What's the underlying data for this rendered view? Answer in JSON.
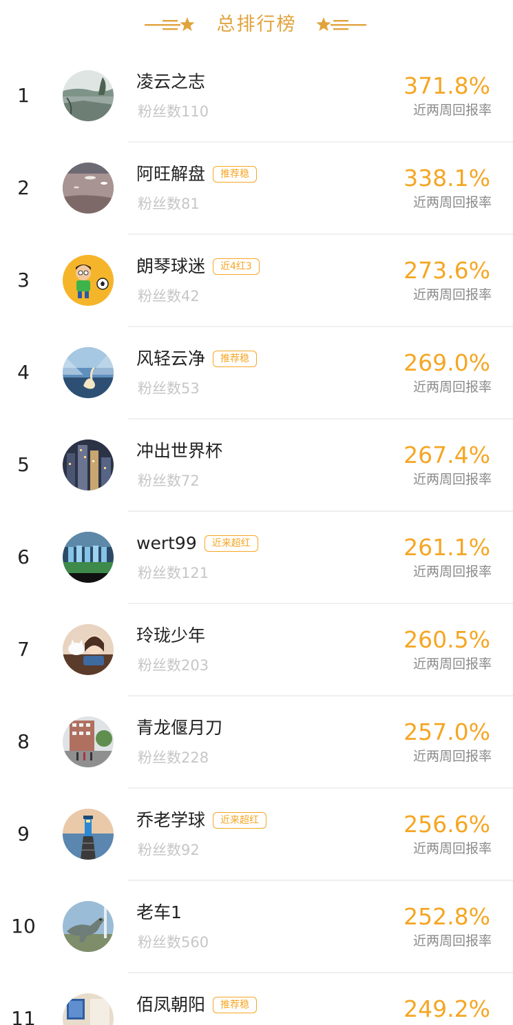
{
  "colors": {
    "accent": "#f5a623",
    "title": "#e1a33d",
    "text": "#222222",
    "muted_text": "#8a8a8a",
    "fans_text": "#c6c6c6",
    "divider": "#efefef"
  },
  "header": {
    "title": "总排行榜",
    "left_decoration_icon": "line-star-left-icon",
    "right_decoration_icon": "star-line-right-icon"
  },
  "rankings": [
    {
      "rank": "1",
      "name": "凌云之志",
      "tag": "",
      "fans": "粉丝数110",
      "rate": "371.8%",
      "rate_label": "近两周回报率",
      "avatar": "lake-landscape-avatar"
    },
    {
      "rank": "2",
      "name": "阿旺解盘",
      "tag": "推荐稳",
      "fans": "粉丝数81",
      "rate": "338.1%",
      "rate_label": "近两周回报率",
      "avatar": "boats-harbor-avatar"
    },
    {
      "rank": "3",
      "name": "朗琴球迷",
      "tag": "近4红3",
      "fans": "粉丝数42",
      "rate": "273.6%",
      "rate_label": "近两周回报率",
      "avatar": "cartoon-soccer-boy-avatar"
    },
    {
      "rank": "4",
      "name": "风轻云净",
      "tag": "推荐稳",
      "fans": "粉丝数53",
      "rate": "269.0%",
      "rate_label": "近两周回报率",
      "avatar": "swan-avatar"
    },
    {
      "rank": "5",
      "name": "冲出世界杯",
      "tag": "",
      "fans": "粉丝数72",
      "rate": "267.4%",
      "rate_label": "近两周回报率",
      "avatar": "city-night-avatar"
    },
    {
      "rank": "6",
      "name": "wert99",
      "tag": "近来超红",
      "fans": "粉丝数121",
      "rate": "261.1%",
      "rate_label": "近两周回报率",
      "avatar": "football-team-avatar"
    },
    {
      "rank": "7",
      "name": "玲珑少年",
      "tag": "",
      "fans": "粉丝数203",
      "rate": "260.5%",
      "rate_label": "近两周回报率",
      "avatar": "girl-with-cat-avatar"
    },
    {
      "rank": "8",
      "name": "青龙偃月刀",
      "tag": "",
      "fans": "粉丝数228",
      "rate": "257.0%",
      "rate_label": "近两周回报率",
      "avatar": "building-street-avatar"
    },
    {
      "rank": "9",
      "name": "乔老学球",
      "tag": "近来超红",
      "fans": "粉丝数92",
      "rate": "256.6%",
      "rate_label": "近两周回报率",
      "avatar": "lighthouse-avatar"
    },
    {
      "rank": "10",
      "name": "老车1",
      "tag": "",
      "fans": "粉丝数560",
      "rate": "252.8%",
      "rate_label": "近两周回报率",
      "avatar": "dinosaur-avatar"
    },
    {
      "rank": "11",
      "name": "佰凤朝阳",
      "tag": "推荐稳",
      "fans": "",
      "rate": "249.2%",
      "rate_label": "",
      "avatar": "living-room-avatar"
    }
  ]
}
